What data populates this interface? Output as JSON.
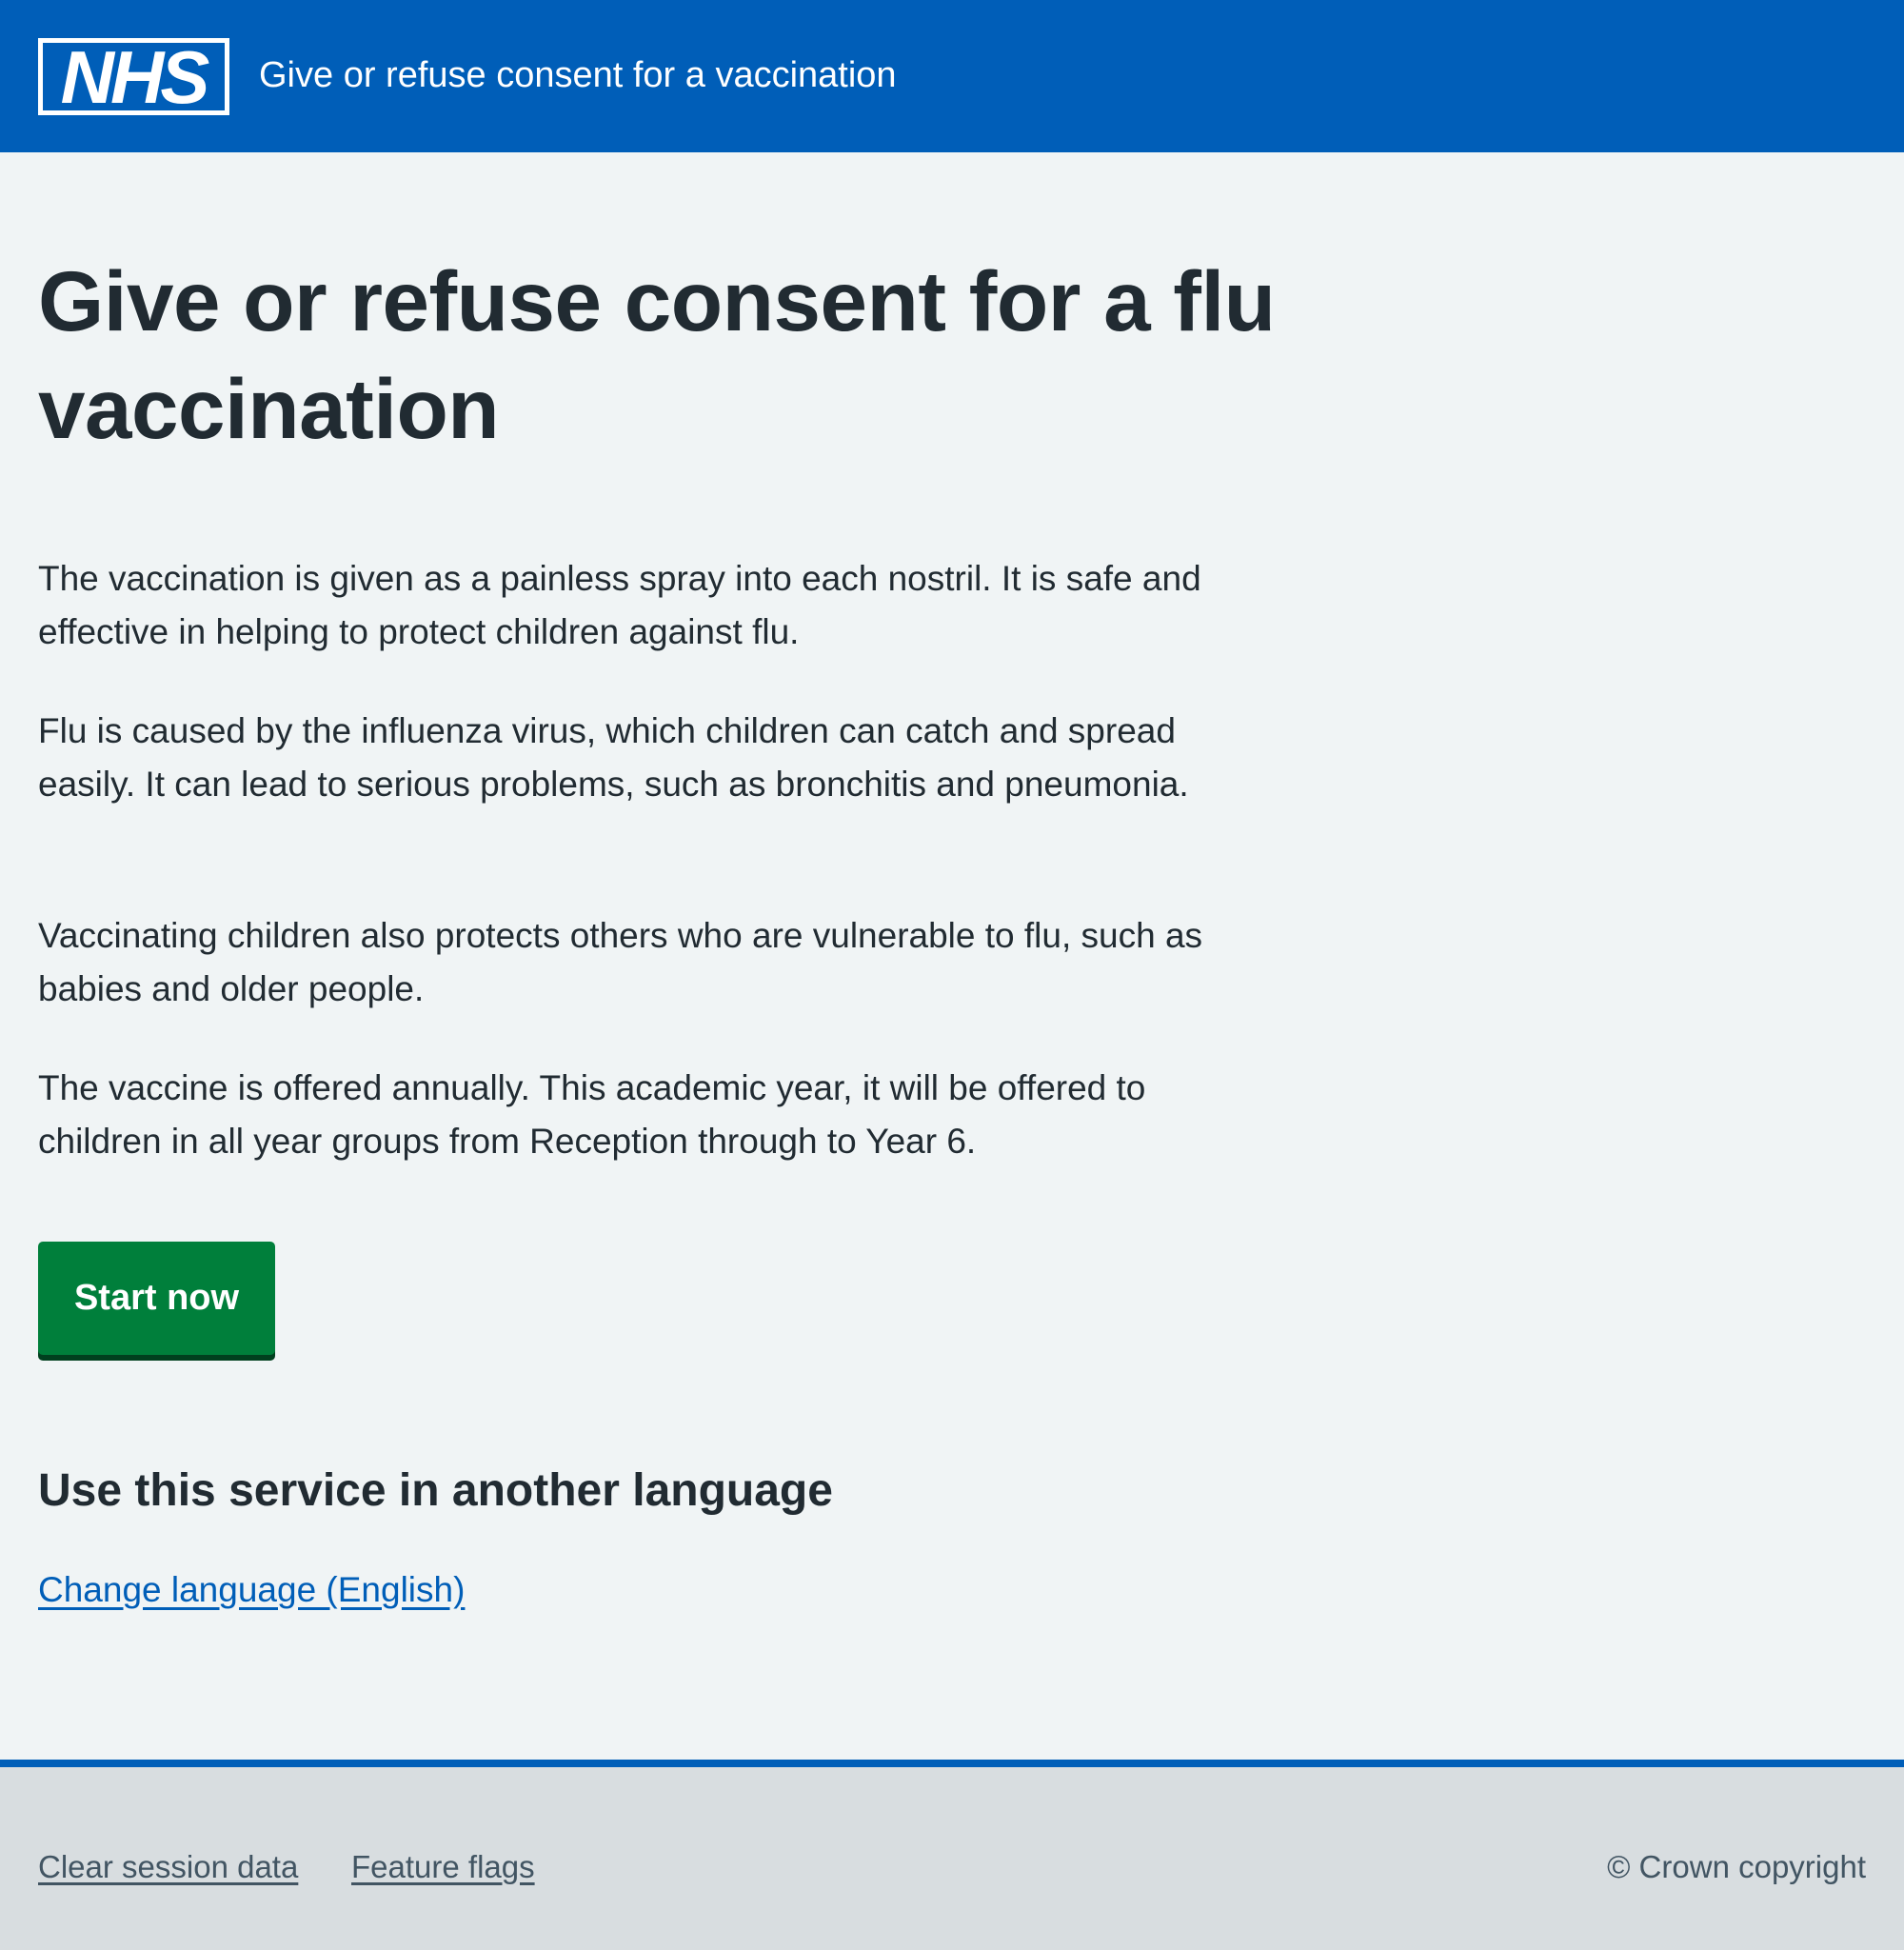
{
  "header": {
    "logo_text": "NHS",
    "service_name": "Give or refuse consent for a vaccination"
  },
  "main": {
    "title": "Give or refuse consent for a flu vaccination",
    "paragraphs": [
      "The vaccination is given as a painless spray into each nostril. It is safe and effective in helping to protect children against flu.",
      "Flu is caused by the influenza virus, which children can catch and spread easily. It can lead to serious problems, such as bronchitis and pneumonia.",
      "Vaccinating children also protects others who are vulnerable to flu, such as babies and older people.",
      "The vaccine is offered annually. This academic year, it will be offered to children in all year groups from Reception through to Year 6."
    ],
    "start_button": "Start now",
    "language_heading": "Use this service in another language",
    "language_link": "Change language (English)"
  },
  "footer": {
    "links": [
      "Clear session data",
      "Feature flags"
    ],
    "copyright": "© Crown copyright"
  },
  "colors": {
    "nhs_blue": "#005eb8",
    "background": "#f0f4f5",
    "text": "#212b32",
    "button_green": "#007f3b",
    "footer_bg": "#d8dde0",
    "footer_text": "#425563"
  }
}
